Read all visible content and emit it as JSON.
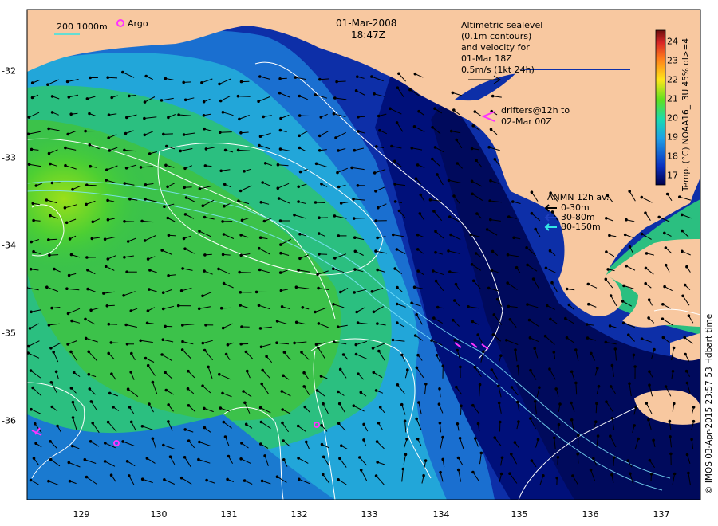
{
  "header": {
    "date": "01-Mar-2008",
    "time": "18:47Z",
    "contour_legend": {
      "depth_200": "200",
      "depth_1000": "1000m"
    },
    "argo_label": "Argo"
  },
  "altimetry_note": {
    "line1": "Altimetric sealevel",
    "line2": "(0.1m contours)",
    "line3": "and velocity for",
    "line4": "01-Mar 18Z",
    "line5": "0.5m/s (1kt 24h)"
  },
  "drifters_note": {
    "line1": "drifters@12h to",
    "line2": "02-Mar 00Z"
  },
  "anmn_legend": {
    "title": "ANMN 12h av.",
    "items": [
      {
        "label": "0-30m",
        "color": "#000000"
      },
      {
        "label": "30-80m",
        "color": "#1f3fbf"
      },
      {
        "label": "80-150m",
        "color": "#33e6e6"
      }
    ]
  },
  "colorbar": {
    "label": "Temp. (°C) NOAA16_L3U 45% ql>=4",
    "ticks": [
      "24",
      "23",
      "22",
      "21",
      "20",
      "19",
      "18",
      "17"
    ],
    "range": [
      16.5,
      24.5
    ]
  },
  "axes": {
    "x_ticks": [
      "129",
      "130",
      "131",
      "132",
      "133",
      "134",
      "135",
      "136",
      "137"
    ],
    "y_ticks": [
      "-32",
      "-33",
      "-34",
      "-35",
      "-36"
    ],
    "lon_range": [
      128.2,
      137.5
    ],
    "lat_range": [
      -36.9,
      -31.3
    ]
  },
  "credit": "© IMOS 03-Apr-2015 23:57:53 Hdbart time",
  "colors": {
    "land": "#f8c8a0",
    "cold": "#00007a",
    "warm": "#33cc33",
    "contour": "#ffffff",
    "drifter": "#ff33ff"
  }
}
